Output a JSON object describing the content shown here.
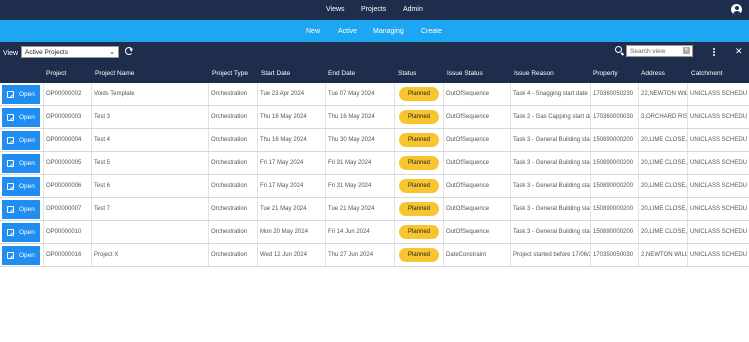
{
  "topnav": {
    "items": [
      "Views",
      "Projects",
      "Admin"
    ]
  },
  "subnav": {
    "items": [
      "New",
      "Active",
      "Managing",
      "Create"
    ]
  },
  "toolbar": {
    "view_label": "View",
    "view_selected": "Active Projects",
    "search_placeholder": "Search view"
  },
  "table": {
    "headers": [
      "Project",
      "Project Name",
      "Project Type",
      "Start Date",
      "End Date",
      "Status",
      "Issue Status",
      "Issue Reason",
      "Property",
      "Address",
      "Catchment"
    ],
    "open_label": "Open",
    "rows": [
      [
        "OP00000002",
        "Voids Template",
        "Orchestration",
        "Tue 23 Apr 2024",
        "Tue 07 May 2024",
        "Planned",
        "OutOfSequence",
        "Task 4 - Snagging start date",
        "170360050230",
        "22,NEWTON WIL",
        "UNICLASS SCHEDU"
      ],
      [
        "OP00000003",
        "Test 3",
        "Orchestration",
        "Thu 16 May 2024",
        "Thu 16 May 2024",
        "Planned",
        "OutOfSequence",
        "Task 2 - Gas Capping start da",
        "170360000030",
        "3,ORCHARD RIS",
        "UNICLASS SCHEDU"
      ],
      [
        "OP00000004",
        "Test 4",
        "Orchestration",
        "Thu 16 May 2024",
        "Thu 30 May 2024",
        "Planned",
        "OutOfSequence",
        "Task 3 - General Building star",
        "150890000200",
        "20,LIME CLOSE,",
        "UNICLASS SCHEDU"
      ],
      [
        "OP00000005",
        "Test 5",
        "Orchestration",
        "Fri 17 May 2024",
        "Fri 31 May 2024",
        "Planned",
        "OutOfSequence",
        "Task 3 - General Building star",
        "150890000200",
        "20,LIME CLOSE,",
        "UNICLASS SCHEDU"
      ],
      [
        "OP00000006",
        "Test 6",
        "Orchestration",
        "Fri 17 May 2024",
        "Fri 31 May 2024",
        "Planned",
        "OutOfSequence",
        "Task 3 - General Building star",
        "150890000200",
        "20,LIME CLOSE,",
        "UNICLASS SCHEDU"
      ],
      [
        "OP00000007",
        "Test 7",
        "Orchestration",
        "Tue 21 May 2024",
        "Tue 21 May 2024",
        "Planned",
        "OutOfSequence",
        "Task 3 - General Building star",
        "150890000200",
        "20,LIME CLOSE,",
        "UNICLASS SCHEDU"
      ],
      [
        "OP00000010",
        "",
        "Orchestration",
        "Mon 20 May 2024",
        "Fri 14 Jun 2024",
        "Planned",
        "OutOfSequence",
        "Task 3 - General Building star",
        "150890000200",
        "20,LIME CLOSE,",
        "UNICLASS SCHEDU"
      ],
      [
        "OP00000016",
        "Project X",
        "Orchestration",
        "Wed 12 Jun 2024",
        "Thu 27 Jun 2024",
        "Planned",
        "DateConstraint",
        "Project started before 17/06/2",
        "170350050030",
        "2,NEWTON WILL",
        "UNICLASS SCHEDU"
      ]
    ]
  },
  "colors": {
    "navy": "#1f2d4d",
    "sky": "#1da7f2",
    "button": "#1f8ef0",
    "badge": "#f7c52f"
  }
}
